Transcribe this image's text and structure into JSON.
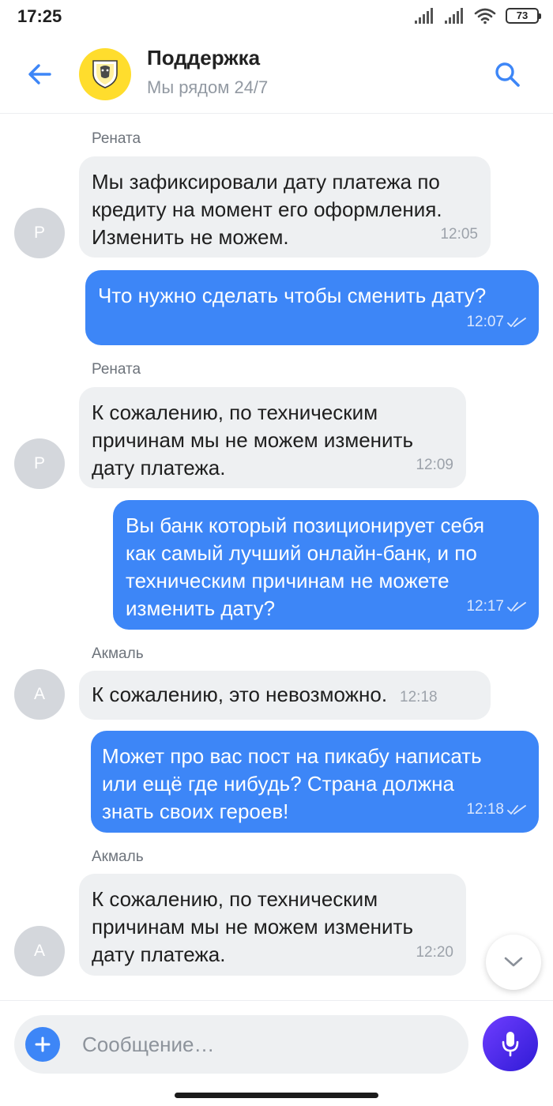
{
  "status_bar": {
    "time": "17:25",
    "battery": "73"
  },
  "header": {
    "title": "Поддержка",
    "subtitle": "Мы рядом 24/7"
  },
  "messages": [
    {
      "sender": "Рената",
      "avatar": "Р",
      "text": "Мы зафиксировали дату платежа по\nкредиту на момент его оформления.\nИзменить не можем.",
      "time": "12:05"
    },
    {
      "text": "Что нужно сделать чтобы сменить дату?",
      "time": "12:07"
    },
    {
      "sender": "Рената",
      "avatar": "Р",
      "text": "К сожалению, по техническим\nпричинам мы не можем изменить\nдату платежа.",
      "time": "12:09"
    },
    {
      "text": "Вы банк который позиционирует себя\nкак самый лучший онлайн-банк, и по\nтехническим причинам не можете\nизменить дату?",
      "time": "12:17"
    },
    {
      "sender": "Акмаль",
      "avatar": "А",
      "text": "К сожалению, это невозможно.",
      "time": "12:18"
    },
    {
      "text": "Может про вас пост на пикабу написать\nили ещё где нибудь? Страна должна\nзнать своих героев!",
      "time": "12:18"
    },
    {
      "sender": "Акмаль",
      "avatar": "А",
      "text": "К сожалению, по техническим\nпричинам мы не можем изменить\nдату платежа.",
      "time": "12:20"
    }
  ],
  "composer": {
    "placeholder": "Сообщение…"
  },
  "colors": {
    "accent": "#3d86f7",
    "incoming_bubble": "#eef0f2",
    "logo_yellow": "#ffdd2d",
    "mic_gradient": "#5a2df0"
  },
  "icons": [
    "back-arrow-icon",
    "bank-logo-icon",
    "search-icon",
    "double-check-icon",
    "chevron-down-icon",
    "plus-icon",
    "microphone-icon"
  ]
}
